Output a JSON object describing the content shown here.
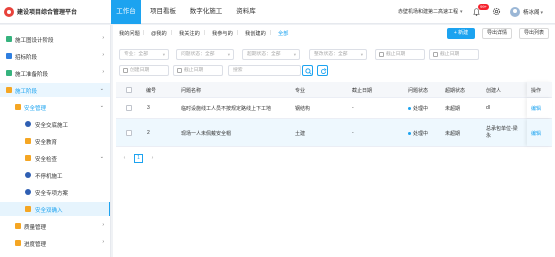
{
  "header": {
    "app_title": "建设项目综合管理平台",
    "nav_tabs": [
      "工作台",
      "项目看板",
      "数字化施工",
      "资料库"
    ],
    "project_name": "赤壁机场和建第二高速工程",
    "notification_count": "99+",
    "user_name": "杨冰阁"
  },
  "sidebar": {
    "items": [
      {
        "label": "施工图设计阶段",
        "arrow": "›"
      },
      {
        "label": "招标阶段",
        "arrow": "›"
      },
      {
        "label": "施工准备阶段",
        "arrow": "›"
      },
      {
        "label": "施工阶段",
        "arrow": "⌄"
      },
      {
        "label": "安全管理",
        "arrow": "⌄"
      },
      {
        "label": "安全交底施工"
      },
      {
        "label": "安全教育"
      },
      {
        "label": "安全检查",
        "arrow": "⌄"
      },
      {
        "label": "不停机施工"
      },
      {
        "label": "安全专项方案"
      },
      {
        "label": "安全双确入"
      },
      {
        "label": "质量管理",
        "arrow": "›"
      },
      {
        "label": "进度管理",
        "arrow": "›"
      }
    ]
  },
  "main": {
    "sub_tabs": [
      "我的问题",
      "@我的",
      "我关注的",
      "我参与的",
      "我创建的",
      "全部"
    ],
    "buttons": {
      "create": "+ 新建",
      "export_detail": "导出详情",
      "export_list": "导出列表"
    },
    "filters": {
      "major": "专业：全部",
      "problem_type": "问题状态：全部",
      "deadline_status": "超期状态：全部",
      "rectify_status": "整改状态：全部",
      "start_date_1": "截止日期",
      "end_date_1": "截止日期",
      "start_date_2": "创建日期",
      "end_date_2": "截止日期",
      "search_placeholder": "搜索"
    },
    "table": {
      "headers": [
        "编号",
        "问题名称",
        "专业",
        "截止日期",
        "问题状态",
        "超期状态",
        "创建人",
        "操作"
      ],
      "rows": [
        {
          "id": "3",
          "name": "临时设施线工人员不按规定路线上下工地",
          "major": "钢结构",
          "deadline": "-",
          "status": "处理中",
          "overdue": "未超期",
          "creator": "dl",
          "action": "编辑"
        },
        {
          "id": "2",
          "name": "现场一人未佩戴安全帽",
          "major": "土建",
          "deadline": "-",
          "status": "处理中",
          "overdue": "未超期",
          "creator": "总承包单位-梁永",
          "action": "编辑"
        }
      ]
    },
    "pagination": {
      "prev": "‹",
      "current": "1",
      "next": "›"
    }
  },
  "colors": {
    "accent": "#1ca3f0",
    "badge": "#f5222d"
  }
}
